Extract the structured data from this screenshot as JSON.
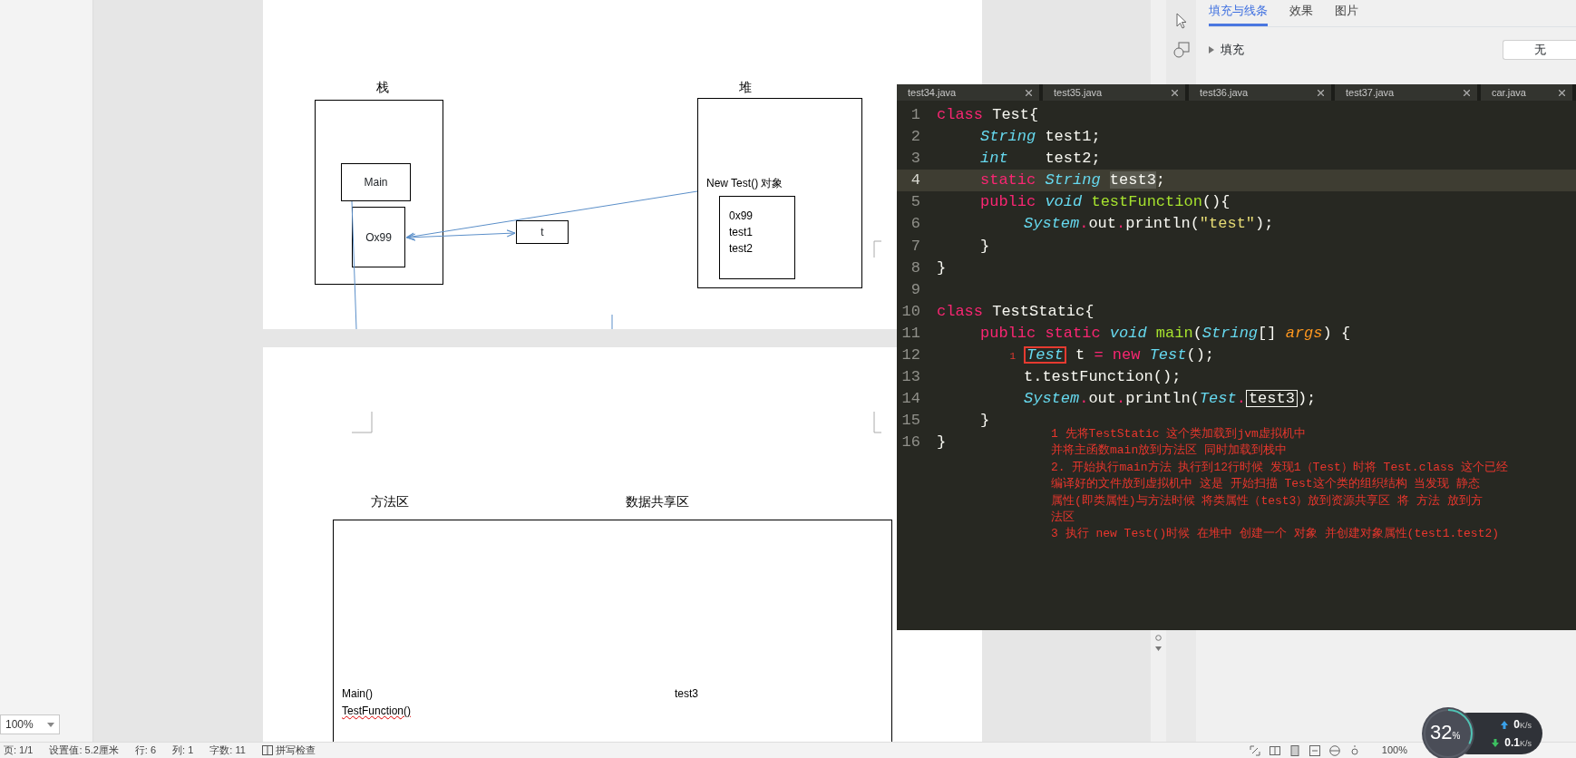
{
  "left_panel": {
    "zoom": "100%"
  },
  "document": {
    "page_1": {
      "stack_label": "栈",
      "heap_label": "堆",
      "stack_frames": [
        "Main",
        "Ox99"
      ],
      "variable": "t",
      "object_label": "New Test()  对象",
      "object_fields": [
        "0x99",
        "test1",
        "test2"
      ]
    },
    "page_2": {
      "method_area_label": "方法区",
      "shared_area_label": "数据共享区",
      "methods": [
        {
          "text": "Main()",
          "misspelled": false
        },
        {
          "text": "TestFunction()",
          "misspelled": true
        }
      ],
      "shared_fields": [
        "test3"
      ]
    }
  },
  "properties_panel": {
    "tabs": [
      {
        "label": "填充与线条",
        "selected": true
      },
      {
        "label": "效果",
        "selected": false
      },
      {
        "label": "图片",
        "selected": false
      }
    ],
    "fill": {
      "label": "填充",
      "value": "无",
      "expanded": false
    }
  },
  "editor": {
    "tabs": [
      "test34.java",
      "test35.java",
      "test36.java",
      "test37.java",
      "car.java"
    ],
    "lines": [
      {
        "number": "1",
        "current": false,
        "tokens": [
          {
            "text": "class",
            "kind": "keyword"
          },
          {
            "text": " Test{",
            "kind": "plain"
          }
        ]
      },
      {
        "number": "2",
        "current": false,
        "tokens": [
          {
            "text": "\tString",
            "kind": "type"
          },
          {
            "text": " test1;",
            "kind": "plain"
          }
        ]
      },
      {
        "number": "3",
        "current": false,
        "tokens": [
          {
            "text": "\tint",
            "kind": "type"
          },
          {
            "text": "    test2;",
            "kind": "plain"
          }
        ]
      },
      {
        "number": "4",
        "current": true,
        "tokens": [
          {
            "text": "\tstatic ",
            "kind": "keyword"
          },
          {
            "text": "String ",
            "kind": "type"
          },
          {
            "text": "test3",
            "kind": "plain",
            "highlighted": true
          },
          {
            "text": ";",
            "kind": "plain"
          }
        ]
      },
      {
        "number": "5",
        "current": false,
        "tokens": [
          {
            "text": "\tpublic ",
            "kind": "keyword"
          },
          {
            "text": "void ",
            "kind": "type"
          },
          {
            "text": "testFunction",
            "kind": "function"
          },
          {
            "text": "(){",
            "kind": "plain"
          }
        ]
      },
      {
        "number": "6",
        "current": false,
        "tokens": [
          {
            "text": "\t\tSystem",
            "kind": "type"
          },
          {
            "text": ".",
            "kind": "keyword"
          },
          {
            "text": "out",
            "kind": "plain"
          },
          {
            "text": ".",
            "kind": "keyword"
          },
          {
            "text": "println(",
            "kind": "plain"
          },
          {
            "text": "\"test\"",
            "kind": "string"
          },
          {
            "text": ");",
            "kind": "plain"
          }
        ]
      },
      {
        "number": "7",
        "current": false,
        "tokens": [
          {
            "text": "\t}",
            "kind": "plain"
          }
        ]
      },
      {
        "number": "8",
        "current": false,
        "tokens": [
          {
            "text": "}",
            "kind": "plain"
          }
        ]
      },
      {
        "number": "9",
        "current": false
      },
      {
        "number": "10",
        "current": false,
        "tokens": [
          {
            "text": "class",
            "kind": "keyword"
          },
          {
            "text": " TestStatic{",
            "kind": "plain"
          }
        ]
      },
      {
        "number": "11",
        "current": false,
        "tokens": [
          {
            "text": "\tpublic static ",
            "kind": "keyword"
          },
          {
            "text": "void ",
            "kind": "type"
          },
          {
            "text": "main",
            "kind": "function"
          },
          {
            "text": "(",
            "kind": "plain"
          },
          {
            "text": "String",
            "kind": "type"
          },
          {
            "text": "[] ",
            "kind": "plain"
          },
          {
            "text": "args",
            "kind": "parameter"
          },
          {
            "text": ") {",
            "kind": "plain"
          }
        ]
      },
      {
        "number": "12",
        "current": false,
        "tokens": [
          {
            "text": "\t1",
            "kind": "marker"
          },
          {
            "text": "Test",
            "kind": "type",
            "flagged": true
          },
          {
            "text": " t ",
            "kind": "plain"
          },
          {
            "text": "= new ",
            "kind": "keyword"
          },
          {
            "text": "Test",
            "kind": "type"
          },
          {
            "text": "();",
            "kind": "plain"
          }
        ]
      },
      {
        "number": "13",
        "current": false,
        "tokens": [
          {
            "text": "\t\tt.testFunction();",
            "kind": "plain"
          }
        ]
      },
      {
        "number": "14",
        "current": false,
        "tokens": [
          {
            "text": "\t\tSystem",
            "kind": "type"
          },
          {
            "text": ".",
            "kind": "keyword"
          },
          {
            "text": "out",
            "kind": "plain"
          },
          {
            "text": ".",
            "kind": "keyword"
          },
          {
            "text": "println(",
            "kind": "plain"
          },
          {
            "text": "Test",
            "kind": "type"
          },
          {
            "text": ".",
            "kind": "keyword"
          },
          {
            "text": "test3",
            "kind": "plain",
            "outlined": true
          },
          {
            "text": ");",
            "kind": "plain"
          }
        ]
      },
      {
        "number": "15",
        "current": false,
        "tokens": [
          {
            "text": "\t}",
            "kind": "plain"
          }
        ]
      },
      {
        "number": "16",
        "current": false,
        "tokens": [
          {
            "text": "}",
            "kind": "plain"
          }
        ]
      }
    ],
    "notes": [
      "1 先将TestStatic 这个类加载到jvm虚拟机中",
      "并将主函数main放到方法区 同时加载到栈中",
      "2. 开始执行main方法 执行到12行时候 发现1（Test）时将 Test.class 这个已经",
      "编译好的文件放到虚拟机中 这是 开始扫描 Test这个类的组织结构 当发现 静态",
      "属性(即类属性)与方法时候 将类属性（test3）放到资源共享区 将 方法 放到方",
      "法区",
      "3 执行 new Test()时候 在堆中 创建一个 对象 并创建对象属性(test1.test2)"
    ]
  },
  "status_bar": {
    "items": [
      "页: 1/1",
      "设置值: 5.2厘米",
      "行: 6",
      "列: 1",
      "字数: 11"
    ],
    "spell_check": "拼写检查",
    "zoom": "100%"
  },
  "net_monitor": {
    "load": "32",
    "unit": "%",
    "level": 0.32,
    "speeds": [
      {
        "kind": "up",
        "value": "0",
        "unit": "K/s"
      },
      {
        "kind": "down",
        "value": "0.1",
        "unit": "K/s"
      }
    ]
  }
}
